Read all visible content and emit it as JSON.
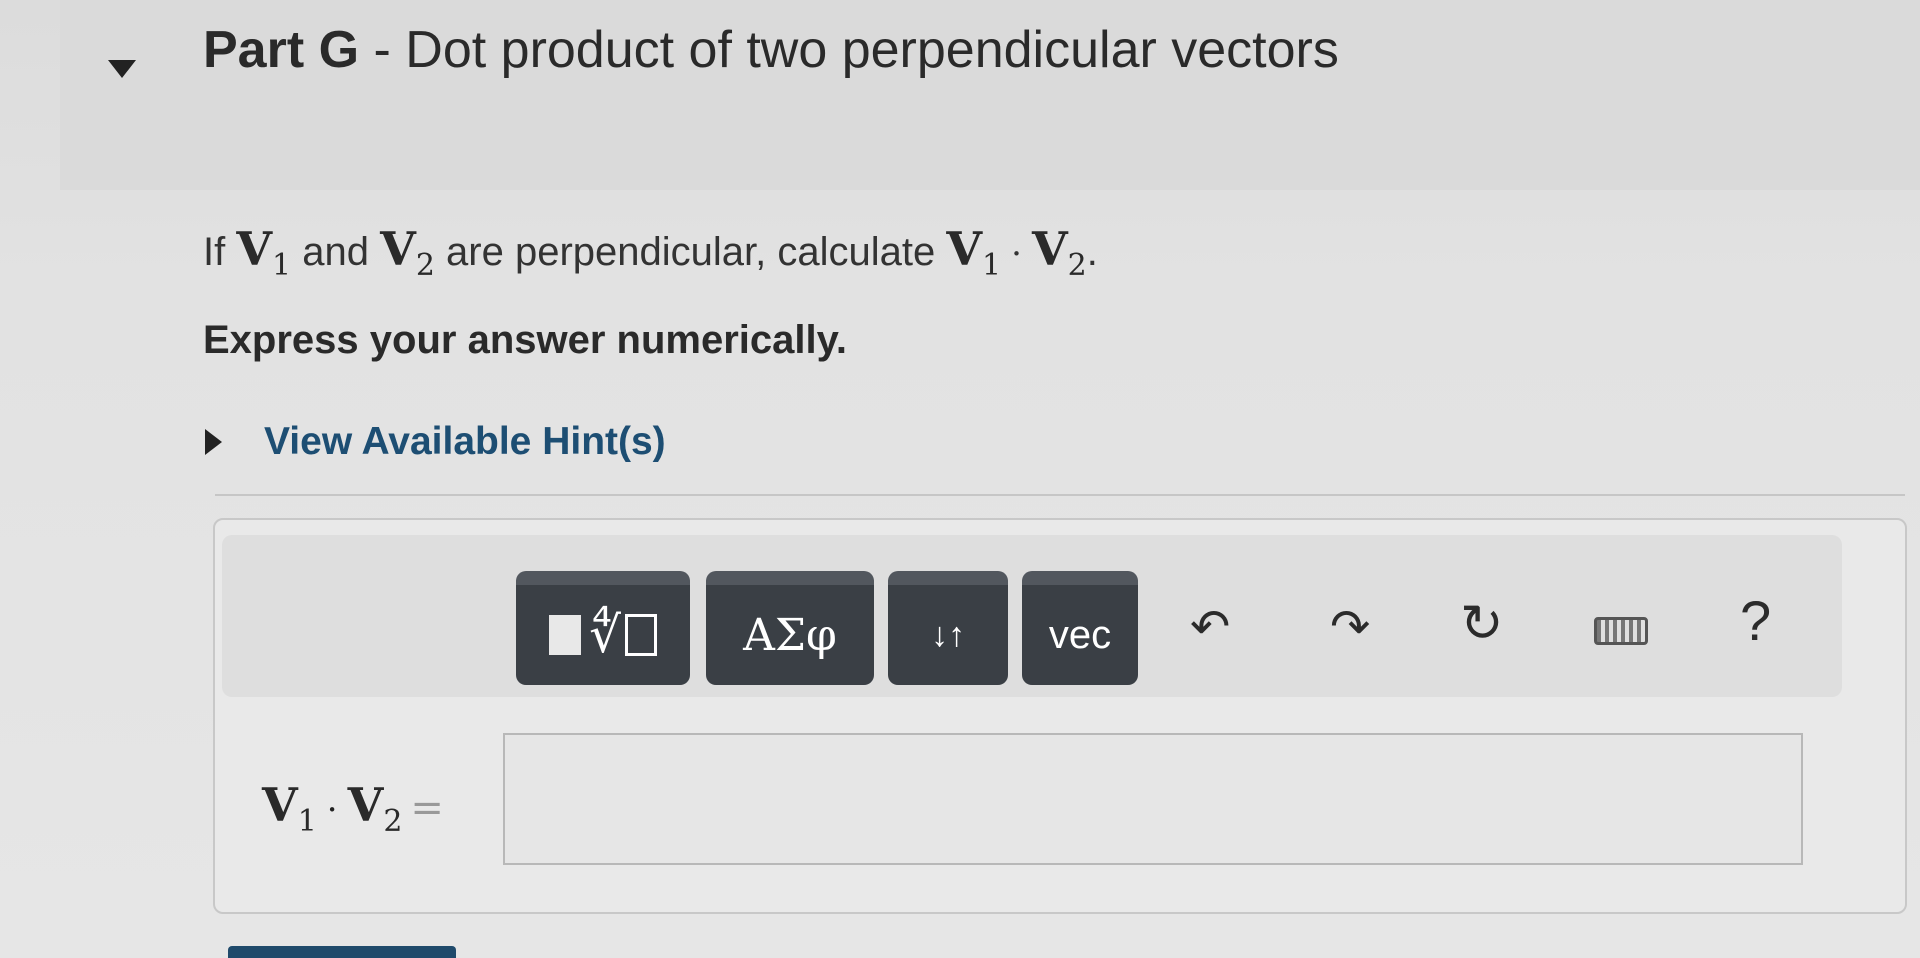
{
  "part": {
    "label": "Part G",
    "separator": " - ",
    "title": "Dot product of two perpendicular vectors"
  },
  "question": {
    "prefix": "If ",
    "var1": "V",
    "sub1": "1",
    "middle": " and ",
    "var2": "V",
    "sub2": "2",
    "suffix": " are perpendicular, calculate ",
    "calc_var1": "V",
    "calc_sub1": "1",
    "dot": "·",
    "calc_var2": "V",
    "calc_sub2": "2",
    "end": "."
  },
  "instruction": "Express your answer numerically.",
  "hint": {
    "label": "View Available Hint(s)"
  },
  "toolbar": {
    "greek_label": "ΑΣφ",
    "subsup_label": "↓↑",
    "vec_label": "vec",
    "undo_glyph": "↶",
    "redo_glyph": "↷",
    "reset_glyph": "↻",
    "help_label": "?"
  },
  "answer": {
    "var1": "V",
    "sub1": "1",
    "dot": "·",
    "var2": "V",
    "sub2": "2",
    "equals": "=",
    "value": ""
  },
  "colors": {
    "hint_link": "#1d4e73",
    "toolbar_button": "#3a3f45",
    "submit_button": "#1f4a6b"
  }
}
